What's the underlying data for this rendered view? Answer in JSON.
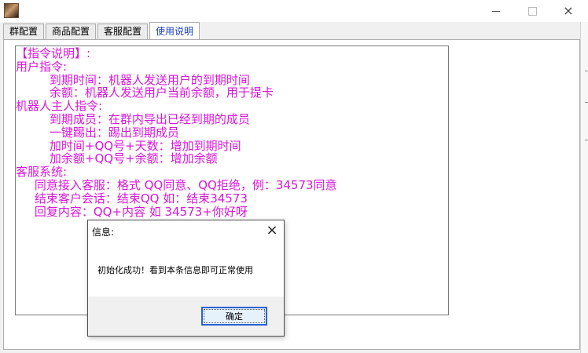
{
  "window": {
    "icon": "user-avatar-icon",
    "controls": {
      "minimize": "minimize-icon",
      "maximize": "maximize-icon",
      "close": "×"
    }
  },
  "tabs": [
    {
      "label": "群配置",
      "active": false
    },
    {
      "label": "商品配置",
      "active": false
    },
    {
      "label": "客服配置",
      "active": false
    },
    {
      "label": "使用说明",
      "active": true
    }
  ],
  "instructions": {
    "lines": [
      "【指令说明】:",
      "用户指令:",
      "         到期时间：机器人发送用户的到期时间",
      "         余额：机器人发送用户当前余额，用于提卡",
      "机器人主人指令:",
      "         到期成员：在群内导出已经到期的成员",
      "         一键踢出：踢出到期成员",
      "         加时间+QQ号+天数：增加到期时间",
      "         加余额+QQ号+余额：增加余额",
      "客服系统:",
      "     同意接入客服：格式 QQ同意、QQ拒绝，例：34573同意",
      "     结束客户会话：结束QQ 如：结束34573",
      "     回复内容：QQ+内容 如 34573+你好呀"
    ],
    "color": "#d916d9"
  },
  "dialog": {
    "title": "信息:",
    "close": "×",
    "message": "初始化成功！看到本条信息即可正常使用",
    "ok_label": "确定"
  }
}
